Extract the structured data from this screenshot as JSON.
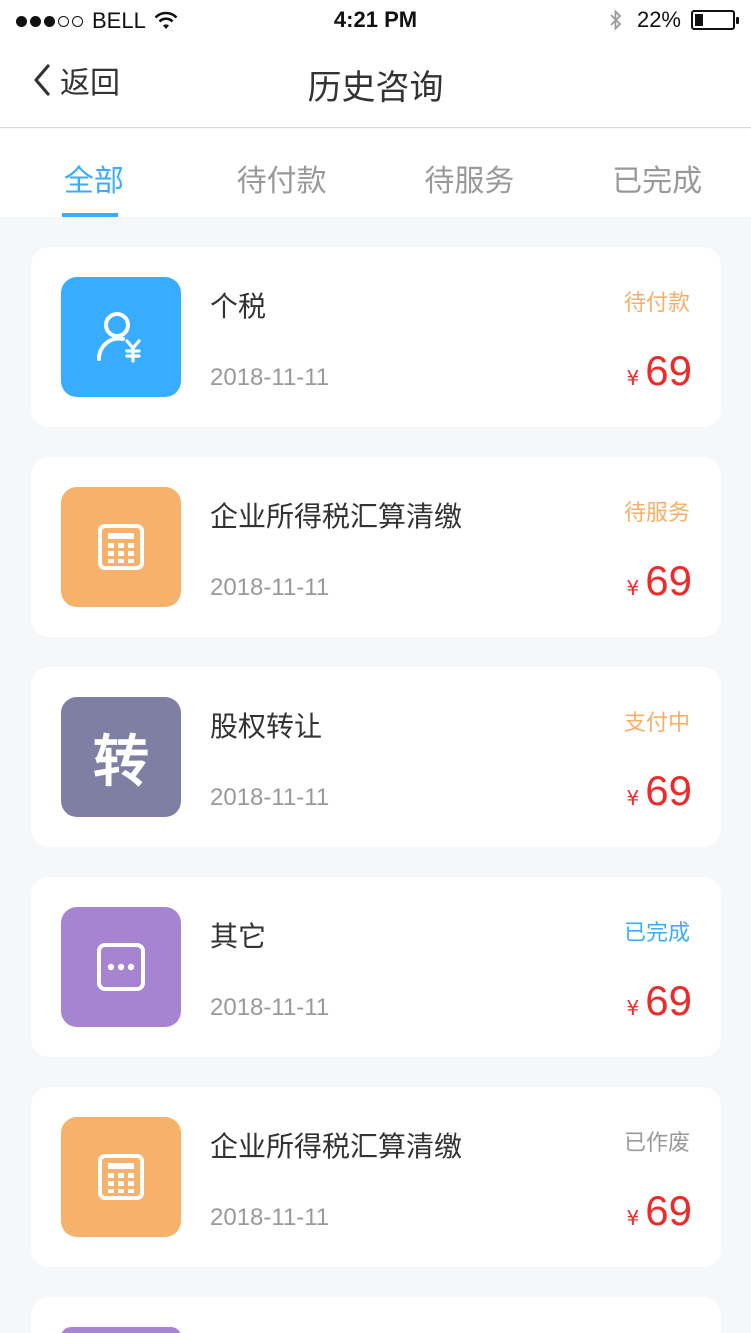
{
  "status_bar": {
    "carrier": "BELL",
    "time": "4:21 PM",
    "battery_pct": "22%",
    "battery_level": 0.22
  },
  "navbar": {
    "back_label": "返回",
    "title": "历史咨询"
  },
  "tabs": [
    {
      "label": "全部",
      "active": true
    },
    {
      "label": "待付款",
      "active": false
    },
    {
      "label": "待服务",
      "active": false
    },
    {
      "label": "已完成",
      "active": false
    }
  ],
  "colors": {
    "accent": "#38adff",
    "pending": "#f6af6a",
    "inactive": "#999999",
    "price": "#ee2a2a"
  },
  "orders": [
    {
      "title": "个税",
      "date": "2018-11-11",
      "status": "待付款",
      "status_color": "#f6af6a",
      "currency": "¥",
      "price": "69",
      "icon": "person-yen-icon",
      "icon_bg": "#38adff"
    },
    {
      "title": "企业所得税汇算清缴",
      "date": "2018-11-11",
      "status": "待服务",
      "status_color": "#f6af6a",
      "currency": "¥",
      "price": "69",
      "icon": "calculator-icon",
      "icon_bg": "#f6b26b"
    },
    {
      "title": "股权转让",
      "date": "2018-11-11",
      "status": "支付中",
      "status_color": "#f6af6a",
      "currency": "¥",
      "price": "69",
      "icon": "transfer-char-icon",
      "icon_glyph": "转",
      "icon_bg": "#7f7fa3"
    },
    {
      "title": "其它",
      "date": "2018-11-11",
      "status": "已完成",
      "status_color": "#38adff",
      "currency": "¥",
      "price": "69",
      "icon": "more-dots-icon",
      "icon_bg": "#a684d1"
    },
    {
      "title": "企业所得税汇算清缴",
      "date": "2018-11-11",
      "status": "已作废",
      "status_color": "#999999",
      "currency": "¥",
      "price": "69",
      "icon": "calculator-icon",
      "icon_bg": "#f6b26b"
    }
  ],
  "partial_card_icon_bg": "#a684d1"
}
